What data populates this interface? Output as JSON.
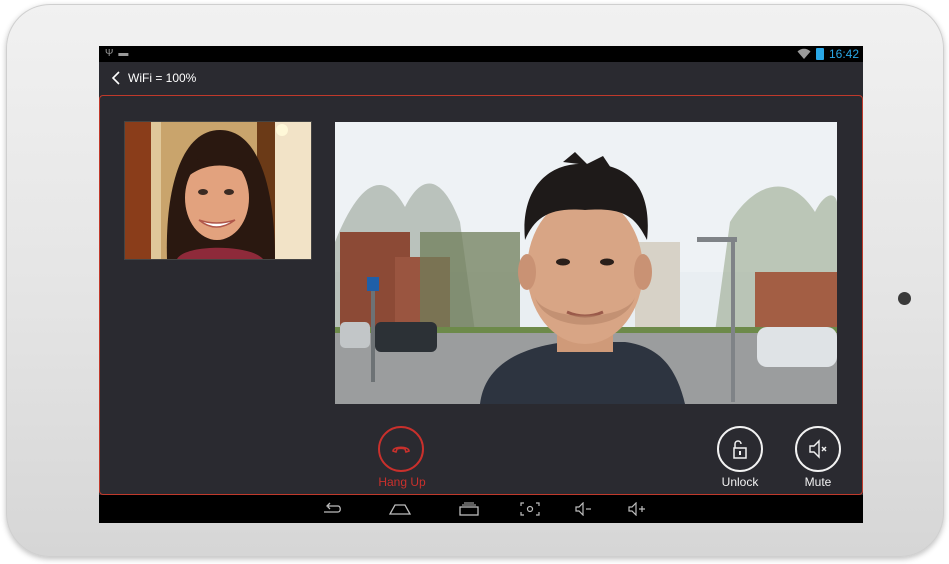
{
  "status_bar": {
    "time": "16:42"
  },
  "title_bar": {
    "title": "WiFi = 100%"
  },
  "call_controls": {
    "hang_up_label": "Hang Up",
    "unlock_label": "Unlock",
    "mute_label": "Mute"
  },
  "colors": {
    "accent_red": "#c9302c",
    "status_blue": "#2aa7e6",
    "screen_background": "#2a2a30"
  },
  "icons": {
    "status_left": [
      "usb-icon",
      "android-debug-icon"
    ],
    "status_right": [
      "wifi-icon",
      "battery-icon"
    ],
    "nav_bar": [
      "back-icon",
      "home-icon",
      "recent-apps-icon",
      "screenshot-icon",
      "volume-down-icon",
      "volume-up-icon"
    ]
  }
}
